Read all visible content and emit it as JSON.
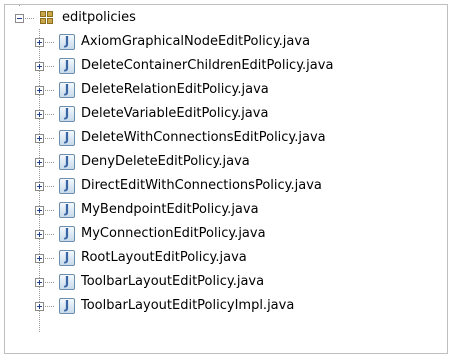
{
  "tree": {
    "package": {
      "label": "editpolicies",
      "icon": "package-icon",
      "expanded": true
    },
    "files": [
      {
        "label": "AxiomGraphicalNodeEditPolicy.java",
        "icon": "java-file-icon"
      },
      {
        "label": "DeleteContainerChildrenEditPolicy.java",
        "icon": "java-file-icon"
      },
      {
        "label": "DeleteRelationEditPolicy.java",
        "icon": "java-file-icon"
      },
      {
        "label": "DeleteVariableEditPolicy.java",
        "icon": "java-file-icon"
      },
      {
        "label": "DeleteWithConnectionsEditPolicy.java",
        "icon": "java-file-icon"
      },
      {
        "label": "DenyDeleteEditPolicy.java",
        "icon": "java-file-icon"
      },
      {
        "label": "DirectEditWithConnectionsPolicy.java",
        "icon": "java-file-icon"
      },
      {
        "label": "MyBendpointEditPolicy.java",
        "icon": "java-file-icon"
      },
      {
        "label": "MyConnectionEditPolicy.java",
        "icon": "java-file-icon"
      },
      {
        "label": "RootLayoutEditPolicy.java",
        "icon": "java-file-icon"
      },
      {
        "label": "ToolbarLayoutEditPolicy.java",
        "icon": "java-file-icon"
      },
      {
        "label": "ToolbarLayoutEditPolicyImpl.java",
        "icon": "java-file-icon"
      }
    ]
  }
}
